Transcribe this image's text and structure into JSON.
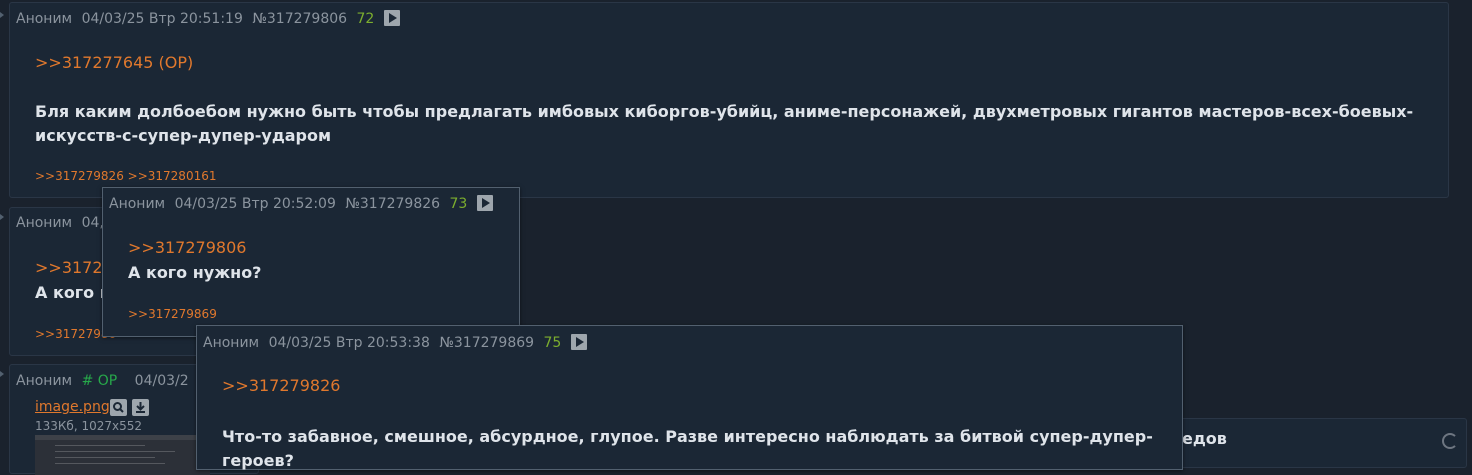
{
  "post1": {
    "author": "Аноним",
    "date": "04/03/25 Втр 20:51:19",
    "number": "№317279806",
    "index": "72",
    "reply_to": ">>317277645 (OP)",
    "text": "Бля каким долбоебом нужно быть чтобы предлагать имбовых киборгов-убийц, аниме-персонажей, двухметровых гигантов мастеров-всех-боевых-искусств-с-супер-дупер-ударом",
    "refs": [
      ">>317279826",
      ">>317280161"
    ]
  },
  "post2": {
    "author": "Аноним",
    "date_fragment": "04,",
    "reply_fragment": ">>3172",
    "text_fragment": "А кого н",
    "refs_fragment": ">>31727986"
  },
  "post3": {
    "author": "Аноним",
    "op_label": "# OP",
    "date_fragment": "04/03/2",
    "file_name": "image.png",
    "file_meta": "133Кб, 1027x552",
    "text_fragment": "едов"
  },
  "popup1": {
    "author": "Аноним",
    "date": "04/03/25 Втр 20:52:09",
    "number": "№317279826",
    "index": "73",
    "reply_to": ">>317279806",
    "text": "А кого нужно?",
    "refs": [
      ">>317279869"
    ]
  },
  "popup2": {
    "author": "Аноним",
    "date": "04/03/25 Втр 20:53:38",
    "number": "№317279869",
    "index": "75",
    "reply_to": ">>317279826",
    "text": "Что-то забавное, смешное, абсурдное, глупое. Разве интересно наблюдать за битвой супер-дупер-героев?"
  },
  "icons": {
    "play": "play-icon",
    "search": "magnifier-icon",
    "download": "download-icon",
    "refresh": "refresh-icon"
  },
  "colors": {
    "background": "#1a222d",
    "post_bg": "#1b2735",
    "link": "#e0782d",
    "index": "#7cae2e",
    "op": "#27a84a"
  }
}
